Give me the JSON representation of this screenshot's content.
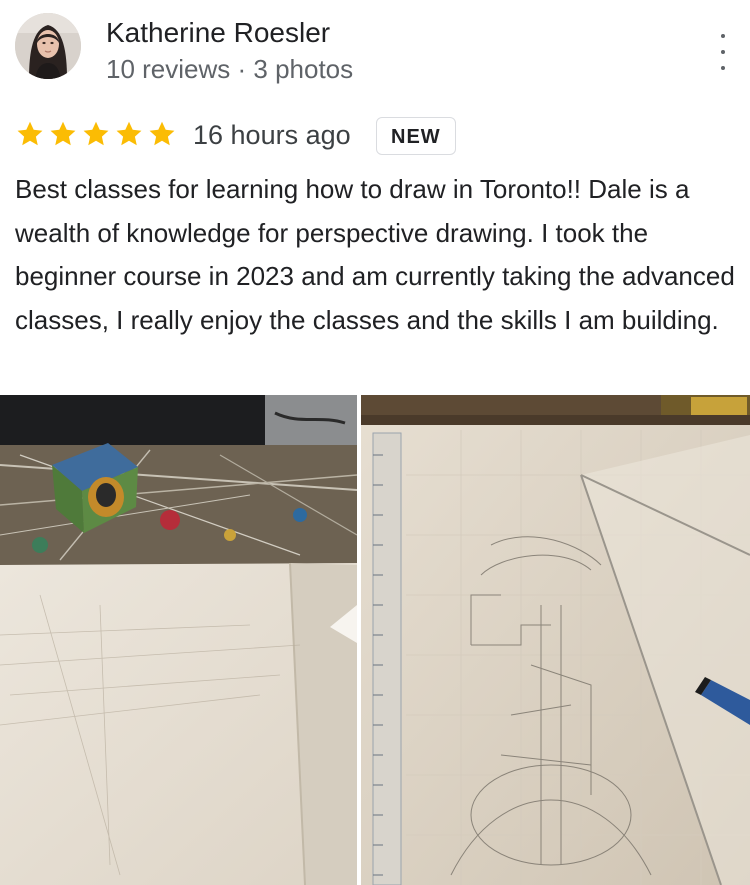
{
  "reviewer": {
    "name": "Katherine Roesler",
    "meta": "10 reviews · 3 photos"
  },
  "review": {
    "rating": 5,
    "max_rating": 5,
    "time": "16 hours ago",
    "badge": "NEW",
    "text": "Best classes for learning how to draw in Toronto!! Dale is a wealth of knowledge for perspective drawing. I took the beginner course in 2023 and am currently taking the advanced classes, I really enjoy the classes and the skills I am building."
  },
  "icons": {
    "star": "star-icon",
    "more": "more-vert-icon"
  },
  "colors": {
    "star": "#fbbc04",
    "secondary_text": "#5f6368",
    "badge_border": "#dadce0"
  }
}
